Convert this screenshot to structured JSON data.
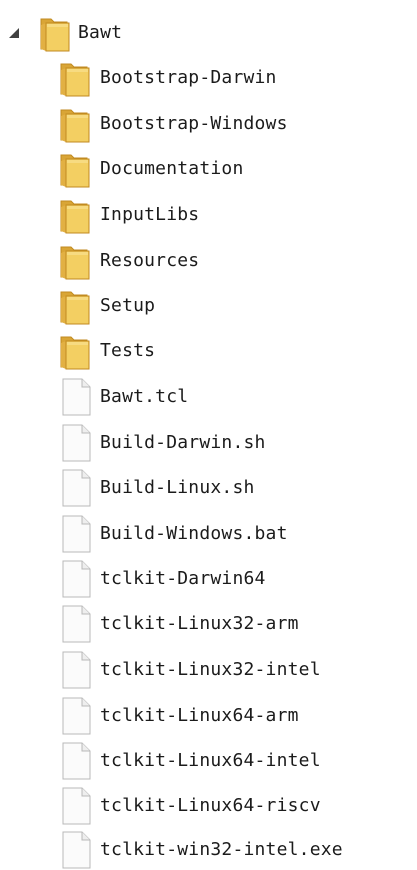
{
  "tree": {
    "root": {
      "label": "Bawt",
      "expanded": true,
      "expander_icon": "triangle-expanded-icon",
      "icon": "folder-icon"
    },
    "folders": [
      {
        "label": "Bootstrap-Darwin",
        "icon": "folder-icon"
      },
      {
        "label": "Bootstrap-Windows",
        "icon": "folder-icon"
      },
      {
        "label": "Documentation",
        "icon": "folder-icon"
      },
      {
        "label": "InputLibs",
        "icon": "folder-icon"
      },
      {
        "label": "Resources",
        "icon": "folder-icon"
      },
      {
        "label": "Setup",
        "icon": "folder-icon"
      },
      {
        "label": "Tests",
        "icon": "folder-icon"
      }
    ],
    "files": [
      {
        "label": "Bawt.tcl",
        "icon": "file-icon"
      },
      {
        "label": "Build-Darwin.sh",
        "icon": "file-icon"
      },
      {
        "label": "Build-Linux.sh",
        "icon": "file-icon"
      },
      {
        "label": "Build-Windows.bat",
        "icon": "file-icon"
      },
      {
        "label": "tclkit-Darwin64",
        "icon": "file-icon"
      },
      {
        "label": "tclkit-Linux32-arm",
        "icon": "file-icon"
      },
      {
        "label": "tclkit-Linux32-intel",
        "icon": "file-icon"
      },
      {
        "label": "tclkit-Linux64-arm",
        "icon": "file-icon"
      },
      {
        "label": "tclkit-Linux64-intel",
        "icon": "file-icon"
      },
      {
        "label": "tclkit-Linux64-riscv",
        "icon": "file-icon"
      },
      {
        "label": "tclkit-win32-intel.exe",
        "icon": "file-icon"
      }
    ],
    "colors": {
      "folder_front": "#f3cf62",
      "folder_back": "#d9a536",
      "folder_edge": "#c18a20",
      "file_fill": "#fbfbfb",
      "file_edge": "#b8b8b8",
      "expander": "#404040",
      "text": "#1b1b1b"
    }
  }
}
